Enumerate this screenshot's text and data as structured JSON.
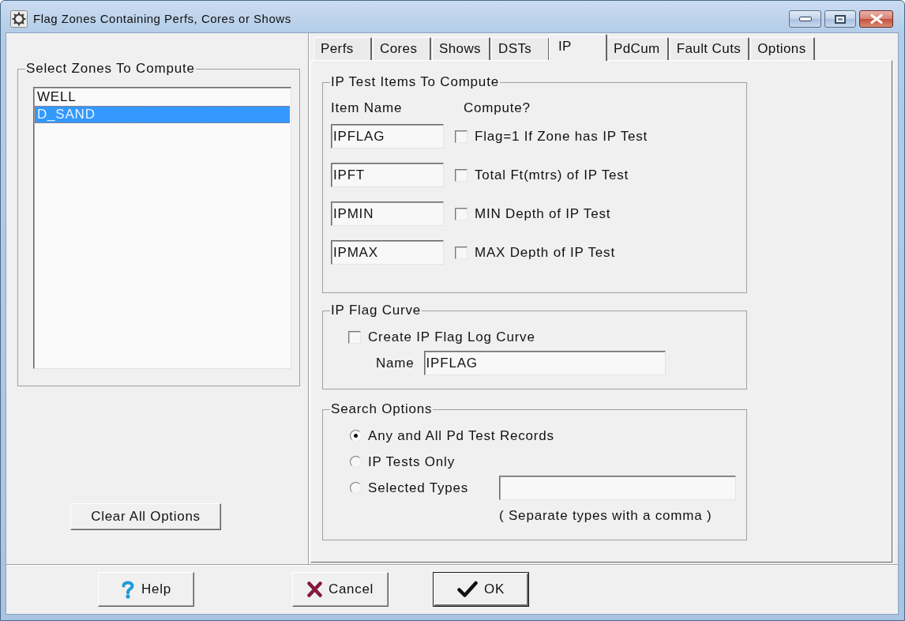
{
  "window": {
    "title": "Flag Zones Containing Perfs, Cores or Shows"
  },
  "zones": {
    "legend": "Select Zones To Compute",
    "items": [
      {
        "label": "WELL",
        "selected": false
      },
      {
        "label": "D_SAND",
        "selected": true
      }
    ],
    "clear_button": "Clear All Options"
  },
  "tabs": [
    {
      "label": "Perfs",
      "selected": false
    },
    {
      "label": "Cores",
      "selected": false
    },
    {
      "label": "Shows",
      "selected": false
    },
    {
      "label": "DSTs",
      "selected": false
    },
    {
      "label": "IP",
      "selected": true
    },
    {
      "label": "PdCum",
      "selected": false
    },
    {
      "label": "Fault Cuts",
      "selected": false
    },
    {
      "label": "Options",
      "selected": false
    }
  ],
  "ip_test_items": {
    "legend": "IP Test Items To Compute",
    "column_headers": [
      "Item Name",
      "Compute?"
    ],
    "rows": [
      {
        "item_name": "IPFLAG",
        "label": "Flag=1 If Zone has IP Test",
        "checked": false
      },
      {
        "item_name": "IPFT",
        "label": "Total Ft(mtrs) of IP Test",
        "checked": false
      },
      {
        "item_name": "IPMIN",
        "label": "MIN Depth of IP Test",
        "checked": false
      },
      {
        "item_name": "IPMAX",
        "label": "MAX Depth of IP Test",
        "checked": false
      }
    ]
  },
  "ip_flag_curve": {
    "legend": "IP Flag Curve",
    "create_label": "Create IP Flag Log Curve",
    "create_checked": false,
    "name_label": "Name",
    "name_value": "IPFLAG"
  },
  "search_options": {
    "legend": "Search Options",
    "options": [
      {
        "kind": "plain",
        "label": "Any and All Pd Test Records",
        "selected": true
      },
      {
        "kind": "plain",
        "label": "IP Tests Only",
        "selected": false
      },
      {
        "kind": "with_field",
        "label": "Selected Types",
        "selected": false
      }
    ],
    "hint": "( Separate types with a comma )"
  },
  "buttons": [
    {
      "kind": "help",
      "label": "Help",
      "default": false
    },
    {
      "kind": "cancel",
      "label": "Cancel",
      "default": false
    },
    {
      "kind": "ok",
      "label": "OK",
      "default": true
    }
  ]
}
